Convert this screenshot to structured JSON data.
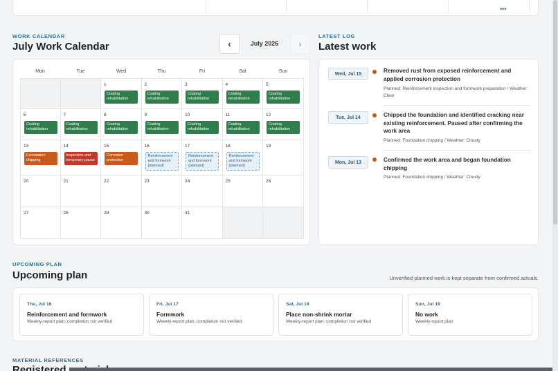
{
  "calendar": {
    "eyebrow": "WORK CALENDAR",
    "title": "July Work Calendar",
    "month_label": "July 2026",
    "prev_icon": "chevron-left-icon",
    "next_icon": "chevron-right-icon",
    "weekdays": [
      "Mon",
      "Tue",
      "Wed",
      "Thu",
      "Fri",
      "Sat",
      "Sun"
    ],
    "weeks": [
      [
        {
          "day": ""
        },
        {
          "day": ""
        },
        {
          "day": "1",
          "event": "Coating rehabilitation",
          "type": "green"
        },
        {
          "day": "2",
          "event": "Coating rehabilitation",
          "type": "green"
        },
        {
          "day": "3",
          "event": "Coating rehabilitation",
          "type": "green"
        },
        {
          "day": "4",
          "event": "Coating rehabilitation",
          "type": "green"
        },
        {
          "day": "5",
          "event": "Coating rehabilitation",
          "type": "green"
        }
      ],
      [
        {
          "day": "6",
          "event": "Coating rehabilitation",
          "type": "green"
        },
        {
          "day": "7",
          "event": "Coating rehabilitation",
          "type": "green"
        },
        {
          "day": "8",
          "event": "Coating rehabilitation",
          "type": "green"
        },
        {
          "day": "9",
          "event": "Coating rehabilitation",
          "type": "green"
        },
        {
          "day": "10",
          "event": "Coating rehabilitation",
          "type": "green"
        },
        {
          "day": "11",
          "event": "Coating rehabilitation",
          "type": "green"
        },
        {
          "day": "12",
          "event": "Coating rehabilitation",
          "type": "green"
        }
      ],
      [
        {
          "day": "13",
          "event": "Foundation chipping",
          "type": "orange"
        },
        {
          "day": "14",
          "event": "Inspection and temporary pause",
          "type": "red"
        },
        {
          "day": "15",
          "event": "Corrosion protection",
          "type": "orange"
        },
        {
          "day": "16",
          "event": "Reinforcement and formwork (planned)",
          "type": "planned"
        },
        {
          "day": "17",
          "event": "Reinforcement and formwork (planned)",
          "type": "planned"
        },
        {
          "day": "18",
          "event": "Reinforcement and formwork (planned)",
          "type": "planned"
        },
        {
          "day": "19"
        }
      ],
      [
        {
          "day": "20"
        },
        {
          "day": "21"
        },
        {
          "day": "22"
        },
        {
          "day": "23"
        },
        {
          "day": "24"
        },
        {
          "day": "25"
        },
        {
          "day": "26"
        }
      ],
      [
        {
          "day": "27"
        },
        {
          "day": "28"
        },
        {
          "day": "29"
        },
        {
          "day": "30"
        },
        {
          "day": "31"
        },
        {
          "day": ""
        },
        {
          "day": ""
        }
      ]
    ]
  },
  "latest_log": {
    "eyebrow": "LATEST LOG",
    "title": "Latest work",
    "entries": [
      {
        "date": "Wed, Jul 15",
        "title": "Removed rust from exposed reinforcement and applied corrosion protection",
        "meta": "Planned: Reinforcement inspection and formwork preparation / Weather: Clear"
      },
      {
        "date": "Tue, Jul 14",
        "title": "Chipped the foundation and identified cracking near existing reinforcement. Paused after confirming the work area",
        "meta": "Planned: Foundation chipping / Weather: Cloudy"
      },
      {
        "date": "Mon, Jul 13",
        "title": "Confirmed the work area and began foundation chipping",
        "meta": "Planned: Foundation chipping / Weather: Cloudy"
      }
    ]
  },
  "upcoming": {
    "eyebrow": "UPCOMING PLAN",
    "title": "Upcoming plan",
    "note": "Unverified planned work is kept separate from confirmed actuals.",
    "items": [
      {
        "date": "Thu, Jul 16",
        "title": "Reinforcement and formwork",
        "status": "Weekly-report plan; completion not verified"
      },
      {
        "date": "Fri, Jul 17",
        "title": "Formwork",
        "status": "Weekly-report plan; completion not verified"
      },
      {
        "date": "Sat, Jul 18",
        "title": "Place non-shrink mortar",
        "status": "Weekly-report plan; completion not verified"
      },
      {
        "date": "Sun, Jul 19",
        "title": "No work",
        "status": "Weekly-report plan"
      }
    ]
  },
  "materials": {
    "eyebrow": "MATERIAL REFERENCES",
    "title": "Registered materials"
  },
  "colors": {
    "accent": "#2b6e8e",
    "event_green": "#2e7d4b",
    "event_orange": "#c75a1c",
    "event_red": "#c0392b",
    "log_dot": "#c85a1c"
  }
}
